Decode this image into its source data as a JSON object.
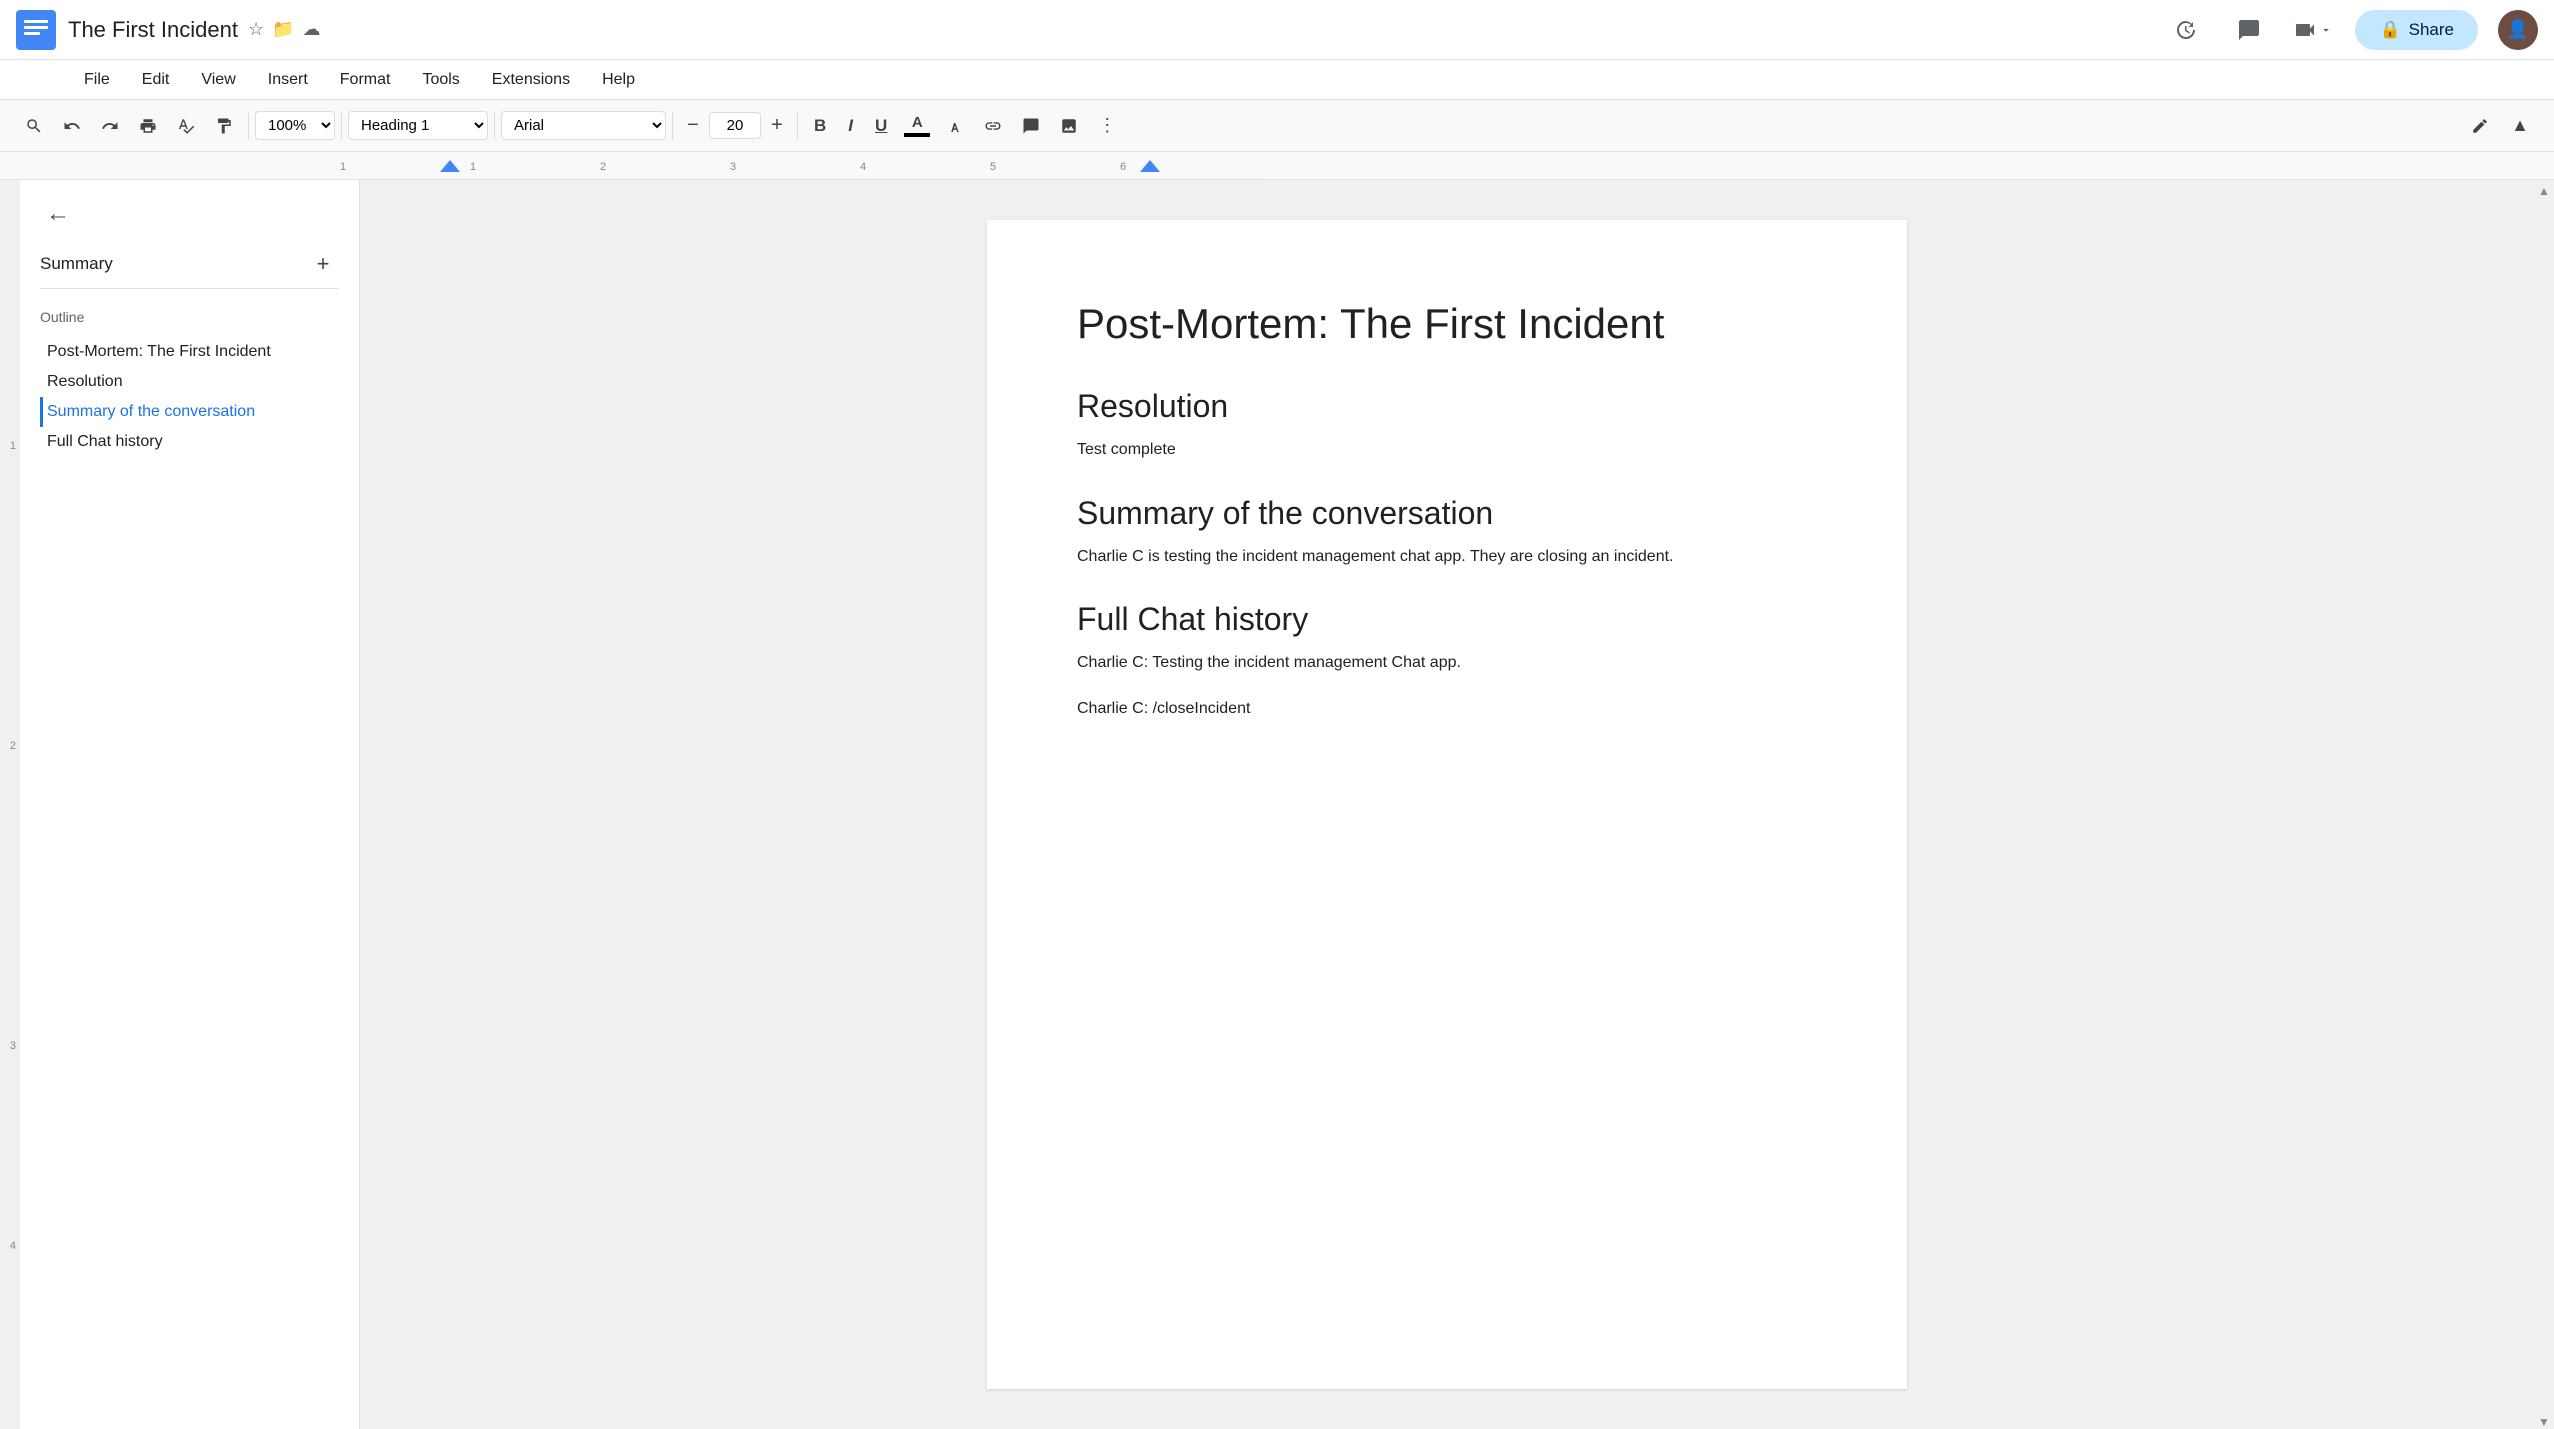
{
  "titleBar": {
    "docTitle": "The First Incident",
    "shareLabel": "Share",
    "shareIcon": "🔒"
  },
  "menuBar": {
    "items": [
      "File",
      "Edit",
      "View",
      "Insert",
      "Format",
      "Tools",
      "Extensions",
      "Help"
    ]
  },
  "toolbar": {
    "zoom": "100%",
    "style": "Heading 1",
    "font": "Arial",
    "fontSize": "20",
    "boldLabel": "B",
    "italicLabel": "I",
    "underlineLabel": "U"
  },
  "sidebar": {
    "summaryLabel": "Summary",
    "outlineLabel": "Outline",
    "outlineItems": [
      {
        "label": "Post-Mortem: The First Incident",
        "active": false
      },
      {
        "label": "Resolution",
        "active": false
      },
      {
        "label": "Summary of the conversation",
        "active": true
      },
      {
        "label": "Full Chat history",
        "active": false
      }
    ]
  },
  "document": {
    "title": "Post-Mortem: The First Incident",
    "sections": [
      {
        "heading": "Resolution",
        "body": "Test complete"
      },
      {
        "heading": "Summary of the conversation",
        "body": "Charlie C is testing the incident management chat app. They are closing an incident."
      },
      {
        "heading": "Full Chat history",
        "lines": [
          "Charlie C: Testing the incident management Chat app.",
          "Charlie C: /closeIncident"
        ]
      }
    ]
  }
}
